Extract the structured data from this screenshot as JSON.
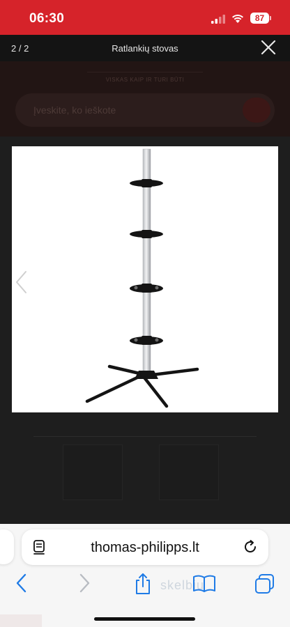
{
  "status_bar": {
    "time": "06:30",
    "battery": "87"
  },
  "gallery": {
    "counter": "2 / 2",
    "title": "Ratlankių stovas"
  },
  "site": {
    "tagline": "VISKAS KAIP IR TURI BŪTI",
    "search_placeholder": "Įveskite, ko ieškote"
  },
  "browser": {
    "url": "thomas-philipps.lt",
    "watermark": "skelbiu"
  },
  "colors": {
    "status_bar": "#d6232a",
    "overlay": "#141414",
    "browser_bar": "#f6f6f6",
    "accent_blue": "#1f7be6"
  },
  "icons": [
    "signal-icon",
    "wifi-icon",
    "battery-icon",
    "close-icon",
    "chevron-left-icon",
    "reader-icon",
    "reload-icon",
    "back-icon",
    "forward-icon",
    "share-icon",
    "bookmarks-icon",
    "tabs-icon"
  ]
}
